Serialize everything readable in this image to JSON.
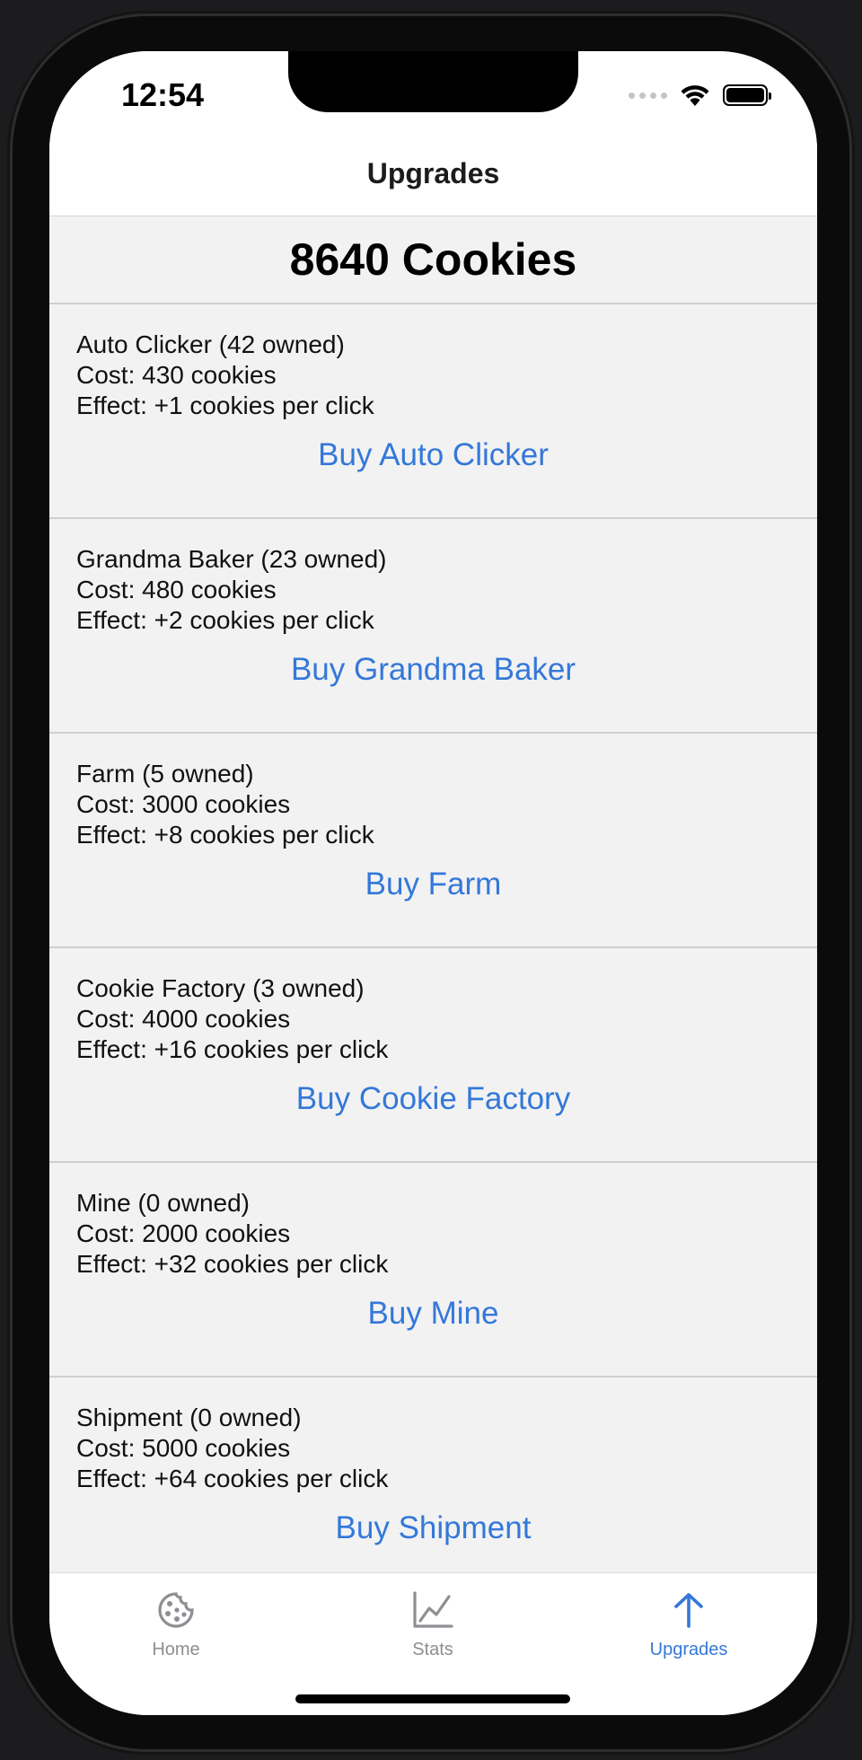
{
  "status_bar": {
    "time": "12:54"
  },
  "nav": {
    "title": "Upgrades"
  },
  "cookies": {
    "count_label": "8640 Cookies"
  },
  "upgrades": [
    {
      "title": "Auto Clicker (42 owned)",
      "cost": "Cost: 430 cookies",
      "effect": "Effect: +1 cookies per click",
      "buy_label": "Buy Auto Clicker"
    },
    {
      "title": "Grandma Baker (23 owned)",
      "cost": "Cost: 480 cookies",
      "effect": "Effect: +2 cookies per click",
      "buy_label": "Buy Grandma Baker"
    },
    {
      "title": "Farm (5 owned)",
      "cost": "Cost: 3000 cookies",
      "effect": "Effect: +8 cookies per click",
      "buy_label": "Buy Farm"
    },
    {
      "title": "Cookie Factory (3 owned)",
      "cost": "Cost: 4000 cookies",
      "effect": "Effect: +16 cookies per click",
      "buy_label": "Buy Cookie Factory"
    },
    {
      "title": "Mine (0 owned)",
      "cost": "Cost: 2000 cookies",
      "effect": "Effect: +32 cookies per click",
      "buy_label": "Buy Mine"
    },
    {
      "title": "Shipment (0 owned)",
      "cost": "Cost: 5000 cookies",
      "effect": "Effect: +64 cookies per click",
      "buy_label": "Buy Shipment"
    }
  ],
  "tab_bar": {
    "tabs": [
      {
        "label": "Home",
        "icon": "cookie-icon",
        "active": false
      },
      {
        "label": "Stats",
        "icon": "chart-line-icon",
        "active": false
      },
      {
        "label": "Upgrades",
        "icon": "arrow-up-icon",
        "active": true
      }
    ]
  },
  "colors": {
    "accent": "#3478d9",
    "inactive_tab": "#8e8e93",
    "list_background": "#f2f2f2"
  }
}
